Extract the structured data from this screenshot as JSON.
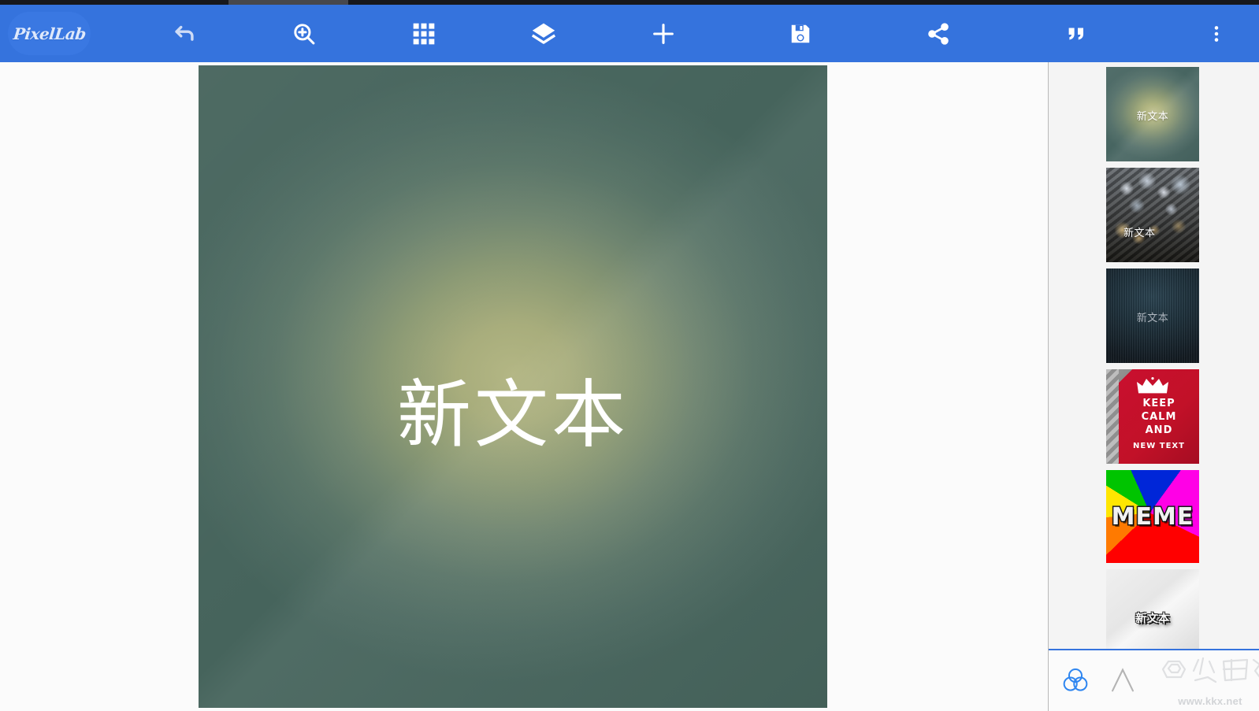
{
  "app": {
    "name": "PixelLab",
    "accent_color": "#3573dd",
    "logo_pill_color": "#3a78e2"
  },
  "statusbar": {
    "notch_color": "#47484c"
  },
  "toolbar": {
    "items": [
      {
        "name": "logo",
        "label": "PixelLab",
        "icon": "pixellab-logo"
      },
      {
        "name": "undo",
        "label": "Undo",
        "icon": "undo-icon"
      },
      {
        "name": "zoom",
        "label": "Zoom",
        "icon": "zoom-in-icon"
      },
      {
        "name": "grid",
        "label": "Grid",
        "icon": "grid-icon"
      },
      {
        "name": "layers",
        "label": "Layers",
        "icon": "layers-icon"
      },
      {
        "name": "add",
        "label": "Add",
        "icon": "plus-icon"
      },
      {
        "name": "save",
        "label": "Save",
        "icon": "save-icon"
      },
      {
        "name": "share",
        "label": "Share",
        "icon": "share-icon"
      },
      {
        "name": "quote",
        "label": "Quote",
        "icon": "quote-icon"
      },
      {
        "name": "more",
        "label": "More options",
        "icon": "more-vertical-icon"
      }
    ]
  },
  "canvas": {
    "text": "新文本",
    "text_color": "#ffffff",
    "background_type": "radial-gradient",
    "background_colors": [
      "#b3b684",
      "#8c9a74",
      "#4e6b62"
    ]
  },
  "templates": {
    "items": [
      {
        "id": "t1",
        "label": "新文本",
        "style": "green-glow"
      },
      {
        "id": "t2",
        "label": "新文本",
        "style": "bokeh-night"
      },
      {
        "id": "t3",
        "label": "新文本",
        "style": "dark-navy-pinstripe"
      },
      {
        "id": "t4",
        "label": "",
        "style": "keep-calm-poster",
        "lines": [
          "KEEP",
          "CALM",
          "AND",
          "NEW TEXT"
        ]
      },
      {
        "id": "t5",
        "label": "MEME",
        "style": "meme-pinwheel"
      },
      {
        "id": "t6",
        "label": "新文本",
        "style": "light-gray-shadow"
      }
    ]
  },
  "bottom_bar": {
    "items": [
      {
        "name": "color-tool",
        "label": "Color",
        "icon": "three-circles-icon",
        "active": true,
        "color": "#2f86f0"
      },
      {
        "name": "text-tool",
        "label": "Text",
        "icon": "letter-a-icon",
        "active": false,
        "color": "#b4b4b4"
      }
    ],
    "watermark": {
      "url": "www.kkx.net"
    }
  }
}
